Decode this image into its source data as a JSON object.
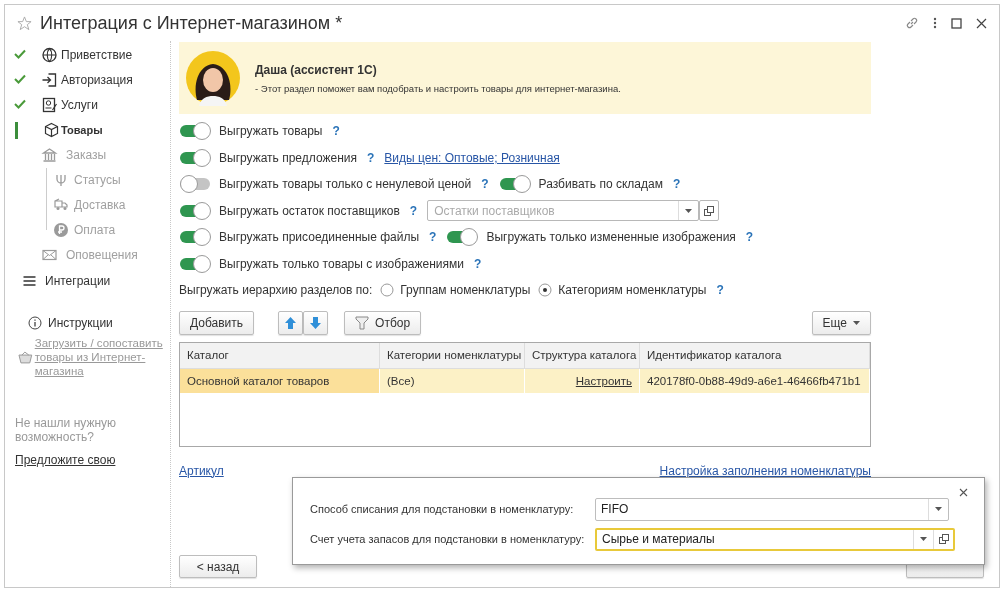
{
  "window": {
    "title": "Интеграция с Интернет-магазином *"
  },
  "sidebar": {
    "steps": [
      {
        "kind": "step",
        "label": "Приветствие",
        "done": true,
        "selected": false,
        "disabled": false
      },
      {
        "kind": "step",
        "label": "Авторизация",
        "done": true,
        "selected": false,
        "disabled": false
      },
      {
        "kind": "step",
        "label": "Услуги",
        "done": true,
        "selected": false,
        "disabled": false
      },
      {
        "kind": "step",
        "label": "Товары",
        "done": false,
        "selected": true,
        "disabled": false
      },
      {
        "kind": "step",
        "label": "Заказы",
        "done": false,
        "selected": false,
        "disabled": true,
        "children": [
          {
            "label": "Статусы",
            "disabled": true
          },
          {
            "label": "Доставка",
            "disabled": true
          },
          {
            "label": "Оплата",
            "disabled": true
          }
        ]
      },
      {
        "kind": "step",
        "label": "Оповещения",
        "done": false,
        "selected": false,
        "disabled": true
      },
      {
        "kind": "section",
        "label": "Интеграции",
        "done": false,
        "selected": false,
        "disabled": false
      }
    ],
    "instructions": "Инструкции",
    "load_link": "Загрузить / сопоставить товары из Интернет-магазина",
    "hint": "Не нашли нужную возможность?",
    "suggest_link": "Предложите свою"
  },
  "assistant": {
    "name": "Даша (ассистент 1С)",
    "message": "- Этот раздел поможет вам подобрать и настроить товары для интернет-магазина."
  },
  "options": [
    [
      {
        "kind": "toggle",
        "label": "Выгружать товары",
        "on": true,
        "help": "?"
      }
    ],
    [
      {
        "kind": "toggle",
        "label": "Выгружать предложения",
        "on": true,
        "help": "?"
      },
      {
        "kind": "link",
        "label": "Виды цен: Оптовые; Розничная"
      }
    ],
    [
      {
        "kind": "toggle",
        "label": "Выгружать товары только с ненулевой ценой",
        "on": false,
        "help": "?"
      },
      {
        "kind": "toggle",
        "label": "Разбивать по складам",
        "on": true,
        "help": "?"
      }
    ],
    [
      {
        "kind": "toggle",
        "label": "Выгружать остаток поставщиков",
        "on": true,
        "help": "?"
      },
      {
        "kind": "field",
        "placeholder": "Остатки поставщиков",
        "open_button": true
      }
    ],
    [
      {
        "kind": "toggle",
        "label": "Выгружать присоединенные файлы",
        "on": true,
        "help": "?"
      },
      {
        "kind": "toggle",
        "label": "Выгружать только измененные изображения",
        "on": true,
        "help": "?"
      }
    ],
    [
      {
        "kind": "toggle",
        "label": "Выгружать только товары с изображениями",
        "on": true,
        "help": "?"
      }
    ],
    [
      {
        "kind": "label",
        "label": "Выгружать иерархию разделов по:"
      },
      {
        "kind": "radio",
        "label": "Группам номенклатуры",
        "selected": false
      },
      {
        "kind": "radio",
        "label": "Категориям номенклатуры",
        "selected": true,
        "help": "?"
      }
    ]
  ],
  "toolbar": {
    "add": "Добавить",
    "filter": "Отбор",
    "more": "Еще"
  },
  "table": {
    "columns": [
      "Каталог",
      "Категории номенклатуры",
      "Структура каталога",
      "Идентификатор каталога"
    ],
    "rows": [
      {
        "selected": true,
        "cells": [
          {
            "kind": "text",
            "text": "Основной каталог товаров"
          },
          {
            "kind": "text",
            "text": "(Все)"
          },
          {
            "kind": "link",
            "text": "Настроить"
          },
          {
            "kind": "text",
            "text": "420178f0-0b88-49d9-a6e1-46466fb471b1"
          }
        ]
      }
    ]
  },
  "links": {
    "article": "Артикул",
    "fill_settings": "Настройка заполнения номенклатуры"
  },
  "popup": {
    "fields": [
      {
        "label": "Способ списания для подстановки в номенклатуру:",
        "value": "FIFO",
        "focused": false,
        "open_button": false
      },
      {
        "label": "Счет учета запасов для подстановки в номенклатуру:",
        "value": "Сырье и материалы",
        "focused": true,
        "open_button": true
      }
    ]
  },
  "buttons": {
    "back": "< назад"
  }
}
